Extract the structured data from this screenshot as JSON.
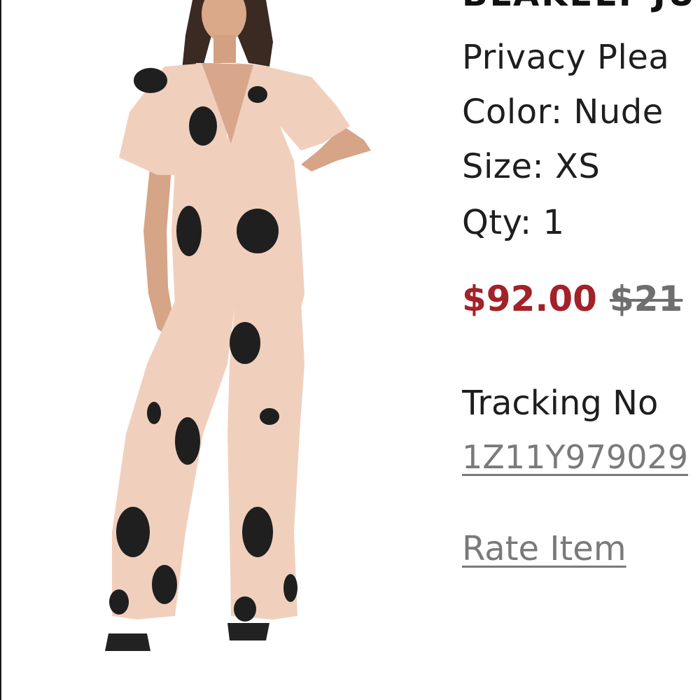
{
  "product": {
    "name": "BLAKELY JU",
    "privacy_line": "Privacy Plea",
    "color_line": "Color: Nude",
    "size_line": "Size: XS",
    "qty_line": "Qty: 1",
    "sale_price": "$92.00",
    "original_price": "$21",
    "image_icon": "product-photo-jumpsuit"
  },
  "tracking": {
    "label": "Tracking No",
    "number": "1Z11Y979029"
  },
  "actions": {
    "rate_item": "Rate Item"
  },
  "colors": {
    "sale_price": "#a32128",
    "original_price": "#6f6f6f",
    "link": "#7a7a7a",
    "fabric": "#f0d0bd",
    "print": "#1f1f1f"
  }
}
